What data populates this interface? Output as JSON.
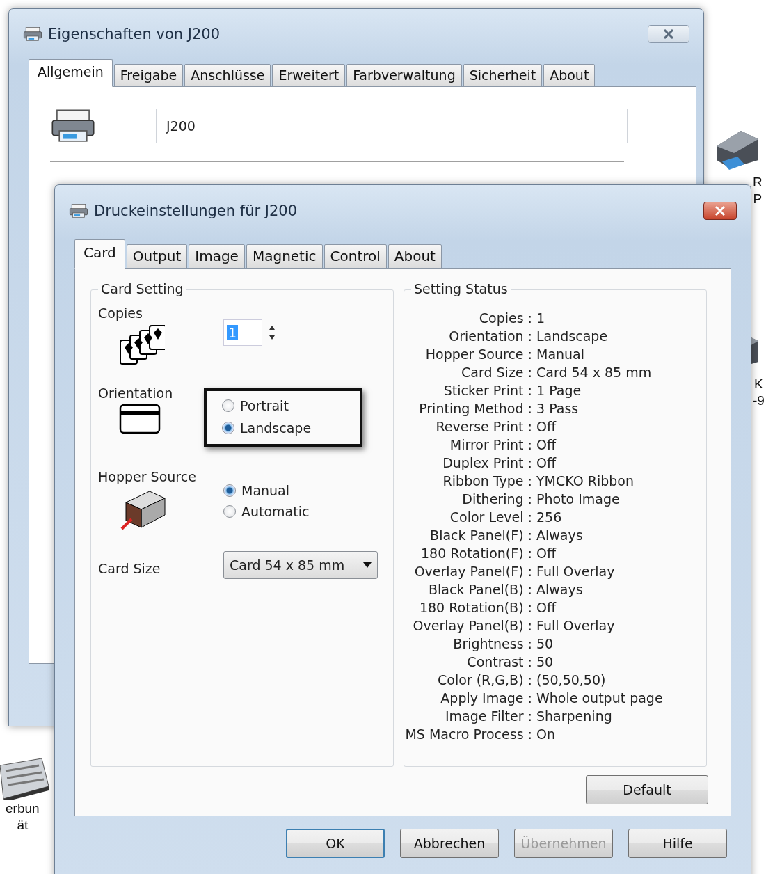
{
  "back_window": {
    "title": "Eigenschaften von J200",
    "tabs": [
      {
        "label": "Allgemein",
        "selected": true
      },
      {
        "label": "Freigabe",
        "selected": false
      },
      {
        "label": "Anschlüsse",
        "selected": false
      },
      {
        "label": "Erweitert",
        "selected": false
      },
      {
        "label": "Farbverwaltung",
        "selected": false
      },
      {
        "label": "Sicherheit",
        "selected": false
      },
      {
        "label": "About",
        "selected": false
      }
    ],
    "printer_name": "J200"
  },
  "desktop_items": [
    {
      "kind": "printer",
      "lines": [
        "R",
        "P"
      ]
    },
    {
      "kind": "printer",
      "lines": [
        "K",
        "-9"
      ]
    },
    {
      "kind": "keyboard",
      "lines": [
        "erbun",
        "ät"
      ]
    }
  ],
  "dialog": {
    "title": "Druckeinstellungen für J200",
    "tabs": [
      {
        "label": "Card",
        "selected": true
      },
      {
        "label": "Output",
        "selected": false
      },
      {
        "label": "Image",
        "selected": false
      },
      {
        "label": "Magnetic",
        "selected": false
      },
      {
        "label": "Control",
        "selected": false
      },
      {
        "label": "About",
        "selected": false
      }
    ],
    "card_setting": {
      "title": "Card Setting",
      "copies_label": "Copies",
      "copies": "1",
      "orientation_label": "Orientation",
      "orientation_options": [
        {
          "label": "Portrait",
          "selected": false
        },
        {
          "label": "Landscape",
          "selected": true
        }
      ],
      "hopper_label": "Hopper Source",
      "hopper_options": [
        {
          "label": "Manual",
          "selected": true
        },
        {
          "label": "Automatic",
          "selected": false
        }
      ],
      "card_size_label": "Card Size",
      "card_size": "Card 54 x 85 mm"
    },
    "setting_status": {
      "title": "Setting Status",
      "rows": [
        {
          "label": "Copies :",
          "value": "1"
        },
        {
          "label": "Orientation :",
          "value": "Landscape"
        },
        {
          "label": "Hopper Source :",
          "value": "Manual"
        },
        {
          "label": "Card Size :",
          "value": "Card 54 x 85 mm"
        },
        {
          "label": "Sticker Print :",
          "value": "1 Page"
        },
        {
          "label": "Printing Method :",
          "value": "3 Pass"
        },
        {
          "label": "Reverse Print :",
          "value": "Off"
        },
        {
          "label": "Mirror Print :",
          "value": "Off"
        },
        {
          "label": "Duplex Print :",
          "value": "Off"
        },
        {
          "label": "Ribbon Type :",
          "value": "YMCKO Ribbon"
        },
        {
          "label": "Dithering :",
          "value": "Photo Image"
        },
        {
          "label": "Color Level :",
          "value": "256"
        },
        {
          "label": "Black Panel(F) :",
          "value": "Always"
        },
        {
          "label": "180 Rotation(F) :",
          "value": "Off"
        },
        {
          "label": "Overlay Panel(F) :",
          "value": "Full Overlay"
        },
        {
          "label": "Black Panel(B) :",
          "value": "Always"
        },
        {
          "label": "180 Rotation(B) :",
          "value": "Off"
        },
        {
          "label": "Overlay Panel(B) :",
          "value": "Full Overlay"
        },
        {
          "label": "Brightness :",
          "value": "50"
        },
        {
          "label": "Contrast :",
          "value": "50"
        },
        {
          "label": "Color (R,G,B) :",
          "value": "(50,50,50)"
        },
        {
          "label": "Apply Image :",
          "value": "Whole output page"
        },
        {
          "label": "Image Filter :",
          "value": "Sharpening"
        },
        {
          "label": "MS Macro Process :",
          "value": "On"
        }
      ]
    },
    "default_button": "Default",
    "buttons": [
      {
        "label": "OK",
        "default": true,
        "disabled": false
      },
      {
        "label": "Abbrechen",
        "default": false,
        "disabled": false
      },
      {
        "label": "Übernehmen",
        "default": false,
        "disabled": true
      },
      {
        "label": "Hilfe",
        "default": false,
        "disabled": false
      }
    ]
  }
}
